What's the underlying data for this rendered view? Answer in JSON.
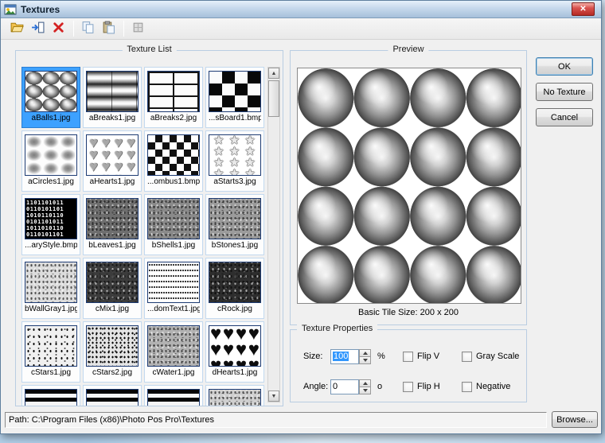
{
  "window": {
    "title": "Textures"
  },
  "icons": {
    "close": "✕",
    "scroll_up": "▲",
    "scroll_down": "▼",
    "toolbar": [
      "open-folder-icon",
      "add-texture-icon",
      "delete-icon",
      "copy-icon",
      "paste-icon",
      "grid-icon"
    ]
  },
  "texture_list": {
    "title": "Texture List",
    "items": [
      {
        "label": "aBalls1.jpg",
        "pattern": "balls",
        "selected": true
      },
      {
        "label": "aBreaks1.jpg",
        "pattern": "breaks-shaded"
      },
      {
        "label": "aBreaks2.jpg",
        "pattern": "bricks"
      },
      {
        "label": "...sBoard1.bmp",
        "pattern": "checker"
      },
      {
        "label": "aCircles1.jpg",
        "pattern": "soft-dots"
      },
      {
        "label": "aHearts1.jpg",
        "pattern": "hearts-gray",
        "glyph": "♥"
      },
      {
        "label": "...ombus1.bmp",
        "pattern": "rhombus"
      },
      {
        "label": "aStarts3.jpg",
        "pattern": "stars",
        "glyph": "★"
      },
      {
        "label": "...aryStyle.bmp",
        "pattern": "binary",
        "glyph": "1101101011 0110101101 1010110110 0101101011 1011010110 0110101101"
      },
      {
        "label": "bLeaves1.jpg",
        "pattern": "noise-leaves"
      },
      {
        "label": "bShells1.jpg",
        "pattern": "noise-shells"
      },
      {
        "label": "bStones1.jpg",
        "pattern": "noise-stones"
      },
      {
        "label": "bWallGray1.jpg",
        "pattern": "noise-wall"
      },
      {
        "label": "cMix1.jpg",
        "pattern": "noise-dark"
      },
      {
        "label": "...domText1.jpg",
        "pattern": "text-lines"
      },
      {
        "label": "cRock.jpg",
        "pattern": "noise-rock"
      },
      {
        "label": "cStars1.jpg",
        "pattern": "speckle-light"
      },
      {
        "label": "cStars2.jpg",
        "pattern": "speckle-dense"
      },
      {
        "label": "cWater1.jpg",
        "pattern": "noise-fine"
      },
      {
        "label": "dHearts1.jpg",
        "pattern": "hearts-black",
        "glyph": "♥"
      },
      {
        "label": "",
        "pattern": "stripes"
      },
      {
        "label": "",
        "pattern": "stripes"
      },
      {
        "label": "",
        "pattern": "stripes"
      },
      {
        "label": "",
        "pattern": "blank"
      }
    ]
  },
  "preview": {
    "title": "Preview",
    "caption": "Basic Tile Size: 200 x 200"
  },
  "properties": {
    "title": "Texture Properties",
    "size_label": "Size:",
    "size_value": "100",
    "size_unit": "%",
    "angle_label": "Angle:",
    "angle_value": "0",
    "angle_unit": "o",
    "flip_v": "Flip V",
    "gray_scale": "Gray Scale",
    "flip_h": "Flip H",
    "negative": "Negative"
  },
  "actions": {
    "ok": "OK",
    "no_texture": "No Texture",
    "cancel": "Cancel",
    "browse": "Browse..."
  },
  "path_bar": {
    "text": "Path: C:\\Program Files (x86)\\Photo Pos Pro\\Textures"
  }
}
